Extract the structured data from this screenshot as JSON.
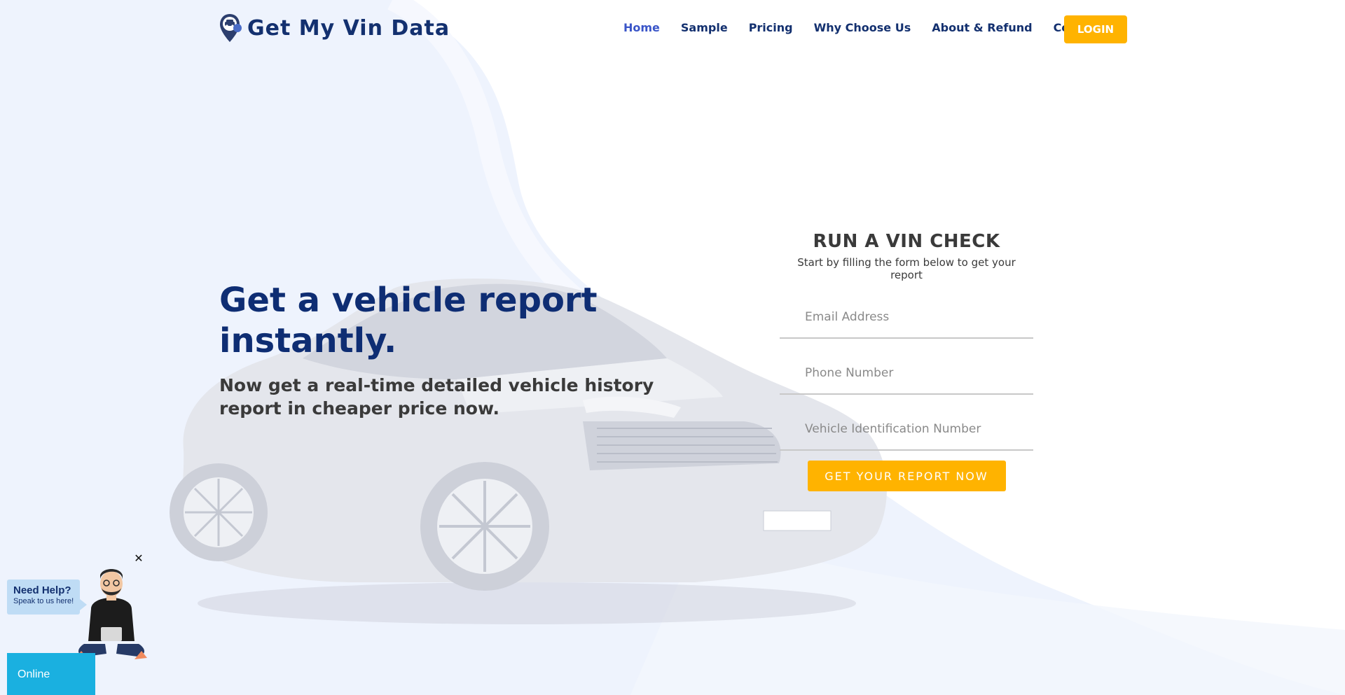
{
  "brand": {
    "name": "Get My Vin Data",
    "logo_icon": "car-pin-icon"
  },
  "nav": {
    "items": [
      {
        "label": "Home",
        "active": true
      },
      {
        "label": "Sample",
        "active": false
      },
      {
        "label": "Pricing",
        "active": false
      },
      {
        "label": "Why Choose Us",
        "active": false
      },
      {
        "label": "About & Refund",
        "active": false
      },
      {
        "label": "Contact",
        "active": false
      }
    ],
    "login_label": "LOGIN"
  },
  "hero": {
    "title": "Get a vehicle report instantly.",
    "subtitle": "Now get a real-time detailed vehicle history report in cheaper price now."
  },
  "form": {
    "title": "RUN A VIN CHECK",
    "subtitle": "Start by filling the form below to get your report",
    "email_placeholder": "Email Address",
    "phone_placeholder": "Phone Number",
    "vin_placeholder": "Vehicle Identification Number",
    "submit_label": "GET YOUR REPORT NOW"
  },
  "help_widget": {
    "title": "Need Help?",
    "subtitle": "Speak to us here!",
    "close_symbol": "✕",
    "status": "Online"
  },
  "colors": {
    "primary": "#13306f",
    "accent": "#ffb300",
    "active_nav": "#3a55c8",
    "online": "#1ab0e0",
    "background_wave": "#eef3fd"
  }
}
